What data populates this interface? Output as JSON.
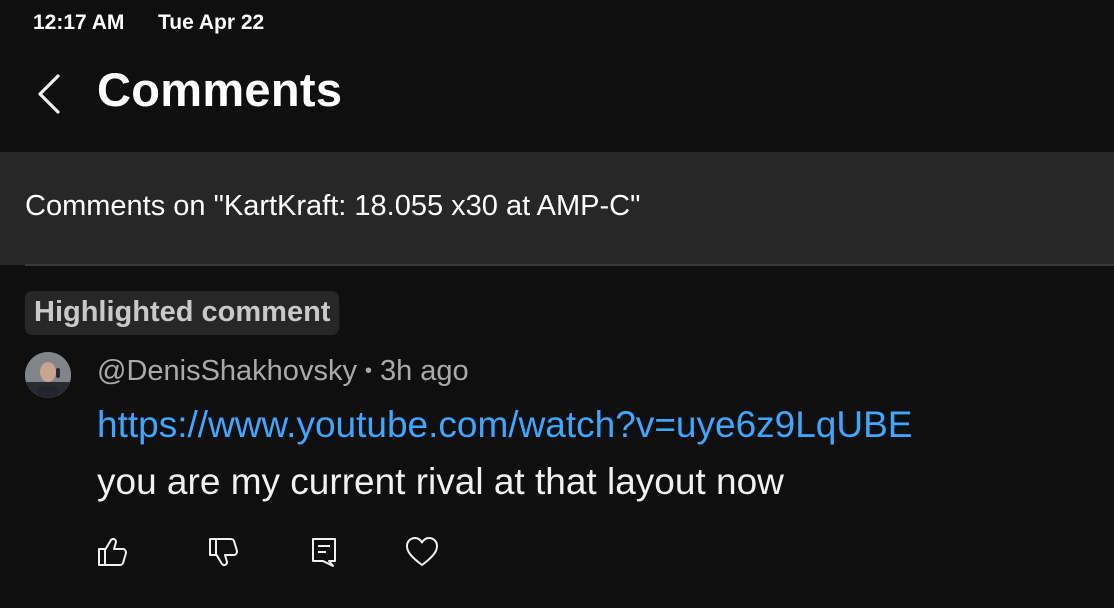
{
  "status_bar": {
    "time": "12:17 AM",
    "date": "Tue Apr 22"
  },
  "header": {
    "title": "Comments",
    "back_icon": "chevron-left-icon"
  },
  "video": {
    "banner_text": "Comments on \"KartKraft: 18.055 x30 at AMP-C\""
  },
  "highlighted_comment": {
    "badge": "Highlighted comment",
    "author": "@DenisShakhovsky",
    "separator": "•",
    "time_ago": "3h ago",
    "link": "https://www.youtube.com/watch?v=uye6z9LqUBE",
    "text": "you are my current rival at that layout now",
    "actions": [
      "like-icon",
      "dislike-icon",
      "reply-icon",
      "heart-icon"
    ]
  },
  "colors": {
    "background": "#0f0f0f",
    "banner": "#272727",
    "link": "#3ea6ff",
    "meta": "#aaaaaa"
  }
}
